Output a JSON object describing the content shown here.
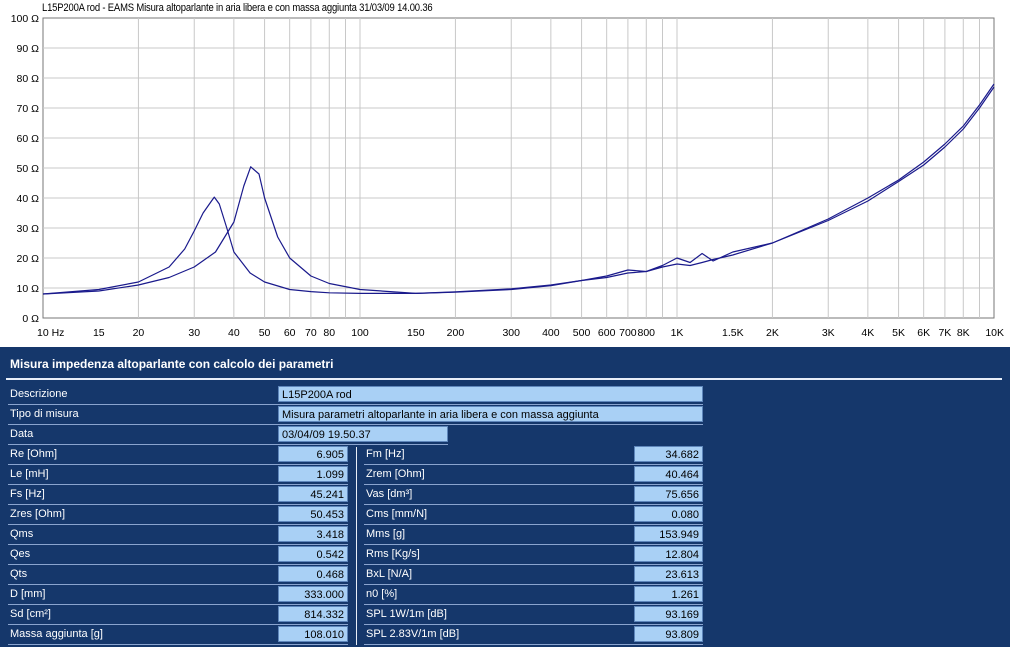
{
  "chart": {
    "title": "L15P200A rod - EAMS Misura altoparlante in aria libera e con massa aggiunta 31/03/09 14.00.36"
  },
  "chart_data": {
    "type": "line",
    "x_scale": "log",
    "xlim": [
      10,
      10000
    ],
    "ylim": [
      0,
      100
    ],
    "grid": true,
    "line_color": "#1a1a8c",
    "x_ticks": [
      {
        "v": 10,
        "label": "10 Hz"
      },
      {
        "v": 15,
        "label": "15"
      },
      {
        "v": 20,
        "label": "20"
      },
      {
        "v": 30,
        "label": "30"
      },
      {
        "v": 40,
        "label": "40"
      },
      {
        "v": 50,
        "label": "50"
      },
      {
        "v": 60,
        "label": "60"
      },
      {
        "v": 70,
        "label": "70"
      },
      {
        "v": 80,
        "label": "80"
      },
      {
        "v": 100,
        "label": "100"
      },
      {
        "v": 150,
        "label": "150"
      },
      {
        "v": 200,
        "label": "200"
      },
      {
        "v": 300,
        "label": "300"
      },
      {
        "v": 400,
        "label": "400"
      },
      {
        "v": 500,
        "label": "500"
      },
      {
        "v": 600,
        "label": "600"
      },
      {
        "v": 700,
        "label": "700"
      },
      {
        "v": 800,
        "label": "800"
      },
      {
        "v": 1000,
        "label": "1K"
      },
      {
        "v": 1500,
        "label": "1.5K"
      },
      {
        "v": 2000,
        "label": "2K"
      },
      {
        "v": 3000,
        "label": "3K"
      },
      {
        "v": 4000,
        "label": "4K"
      },
      {
        "v": 5000,
        "label": "5K"
      },
      {
        "v": 6000,
        "label": "6K"
      },
      {
        "v": 7000,
        "label": "7K"
      },
      {
        "v": 8000,
        "label": "8K"
      },
      {
        "v": 10000,
        "label": "10K"
      }
    ],
    "y_ticks": [
      {
        "v": 0,
        "label": "0 Ω"
      },
      {
        "v": 10,
        "label": "10 Ω"
      },
      {
        "v": 20,
        "label": "20 Ω"
      },
      {
        "v": 30,
        "label": "30 Ω"
      },
      {
        "v": 40,
        "label": "40 Ω"
      },
      {
        "v": 50,
        "label": "50 Ω"
      },
      {
        "v": 60,
        "label": "60 Ω"
      },
      {
        "v": 70,
        "label": "70 Ω"
      },
      {
        "v": 80,
        "label": "80 Ω"
      },
      {
        "v": 90,
        "label": "90 Ω"
      },
      {
        "v": 100,
        "label": "100 Ω"
      }
    ],
    "series": [
      {
        "x": [
          10,
          15,
          20,
          25,
          28,
          30,
          32,
          34,
          34.7,
          36,
          38,
          40,
          45,
          50,
          60,
          70,
          80,
          100,
          150,
          200,
          300,
          400,
          500,
          600,
          700,
          800,
          900,
          1000,
          1100,
          1200,
          1300,
          1500,
          2000,
          3000,
          4000,
          5000,
          6000,
          7000,
          8000,
          9000,
          10000
        ],
        "y": [
          8,
          9.5,
          12,
          17,
          23,
          29,
          35,
          39,
          40.3,
          38,
          30,
          22,
          15,
          12,
          9.5,
          8.8,
          8.4,
          8.2,
          8.2,
          8.6,
          9.5,
          10.8,
          12.5,
          14,
          16,
          15.5,
          17.5,
          20,
          18.5,
          21.5,
          19,
          22,
          25,
          33,
          40,
          46,
          52,
          58,
          64,
          71,
          78
        ]
      },
      {
        "x": [
          10,
          15,
          20,
          25,
          30,
          35,
          40,
          43,
          45.2,
          48,
          50,
          55,
          60,
          70,
          80,
          100,
          150,
          200,
          300,
          400,
          500,
          600,
          700,
          800,
          900,
          1000,
          1100,
          1200,
          1300,
          1500,
          2000,
          3000,
          4000,
          5000,
          6000,
          7000,
          8000,
          9000,
          10000
        ],
        "y": [
          8,
          9,
          11,
          13.5,
          17,
          22,
          32,
          44,
          50.4,
          48,
          40,
          27,
          20,
          14,
          11.5,
          9.5,
          8.2,
          8.7,
          9.7,
          11,
          12.5,
          13.5,
          15,
          15.5,
          17,
          18,
          17.5,
          18.5,
          19.5,
          21,
          25,
          32.5,
          39,
          45.5,
          51,
          57,
          63,
          70,
          77
        ]
      }
    ]
  },
  "panel": {
    "title": "Misura impedenza altoparlante con calcolo dei parametri",
    "descrizione": {
      "label": "Descrizione",
      "value": "L15P200A rod"
    },
    "tipo": {
      "label": "Tipo di misura",
      "value": "Misura parametri altoparlante in aria libera e con massa aggiunta"
    },
    "data": {
      "label": "Data",
      "value": "03/04/09 19.50.37"
    },
    "left_params": [
      {
        "label": "Re [Ohm]",
        "value": "6.905"
      },
      {
        "label": "Le [mH]",
        "value": "1.099"
      },
      {
        "label": "Fs [Hz]",
        "value": "45.241"
      },
      {
        "label": "Zres [Ohm]",
        "value": "50.453"
      },
      {
        "label": "Qms",
        "value": "3.418"
      },
      {
        "label": "Qes",
        "value": "0.542"
      },
      {
        "label": "Qts",
        "value": "0.468"
      },
      {
        "label": "D [mm]",
        "value": "333.000"
      },
      {
        "label": "Sd [cm²]",
        "value": "814.332"
      },
      {
        "label": "Massa aggiunta [g]",
        "value": "108.010"
      }
    ],
    "right_params": [
      {
        "label": "Fm [Hz]",
        "value": "34.682"
      },
      {
        "label": "Zrem [Ohm]",
        "value": "40.464"
      },
      {
        "label": "Vas [dm³]",
        "value": "75.656"
      },
      {
        "label": "Cms [mm/N]",
        "value": "0.080"
      },
      {
        "label": "Mms [g]",
        "value": "153.949"
      },
      {
        "label": "Rms [Kg/s]",
        "value": "12.804"
      },
      {
        "label": "BxL [N/A]",
        "value": "23.613"
      },
      {
        "label": "n0 [%]",
        "value": "1.261"
      },
      {
        "label": "SPL 1W/1m [dB]",
        "value": "93.169"
      },
      {
        "label": "SPL 2.83V/1m [dB]",
        "value": "93.809"
      }
    ]
  }
}
